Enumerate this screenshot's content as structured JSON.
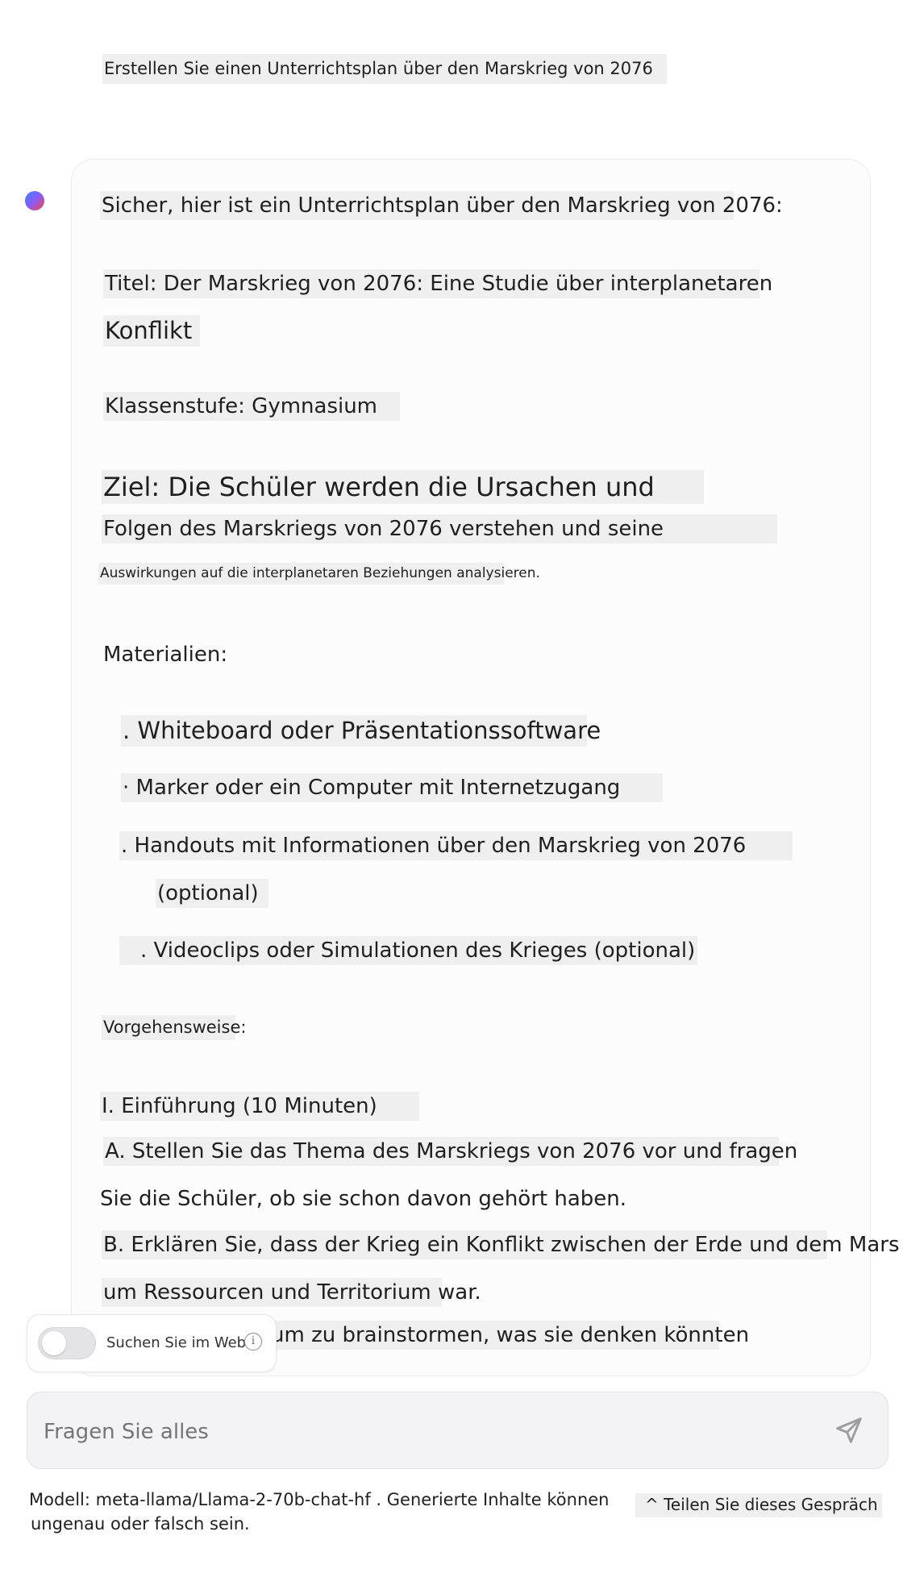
{
  "user_message": "Erstellen Sie einen Unterrichtsplan über den Marskrieg von 2076",
  "assistant": {
    "intro": "Sicher, hier ist ein Unterrichtsplan über den Marskrieg von 2076:",
    "title_line1": "Titel: Der Marskrieg von 2076: Eine Studie über interplanetaren",
    "title_line2": "Konflikt",
    "grade": "Klassenstufe: Gymnasium",
    "goal_line1": "Ziel: Die Schüler werden die Ursachen und",
    "goal_line2": "Folgen des Marskriegs von 2076 verstehen und seine",
    "goal_line3": "Auswirkungen auf die interplanetaren Beziehungen analysieren.",
    "materials_heading": "Materialien:",
    "materials": [
      ". Whiteboard oder Präsentationssoftware",
      "· Marker oder ein Computer mit Internetzugang",
      ". Handouts mit Informationen über den Marskrieg von 2076",
      "(optional)",
      ". Videoclips oder Simulationen des Krieges (optional)"
    ],
    "procedure_heading": "Vorgehensweise:",
    "section_1": "I. Einführung (10 Minuten)",
    "step_a_line1": "A. Stellen Sie das Thema des Marskriegs von 2076 vor und fragen",
    "step_a_line2": "Sie die Schüler, ob sie schon davon gehört haben.",
    "step_b_line1": "B. Erklären Sie, dass der Krieg ein Konflikt zwischen der Erde und dem Mars",
    "step_b_line2": "um Ressourcen und Territorium war.",
    "step_c_partial": "um zu brainstormen, was sie denken könnten"
  },
  "web_search": {
    "label": "Suchen Sie im Web",
    "enabled": false,
    "info_icon": "i"
  },
  "input": {
    "placeholder": "Fragen Sie alles"
  },
  "footer": {
    "model_line1": "Modell: meta-llama/Llama-2-70b-chat-hf . Generierte Inhalte können",
    "model_line2": "ungenau oder falsch sein.",
    "share_label": "^ Teilen Sie dieses Gespräch"
  }
}
